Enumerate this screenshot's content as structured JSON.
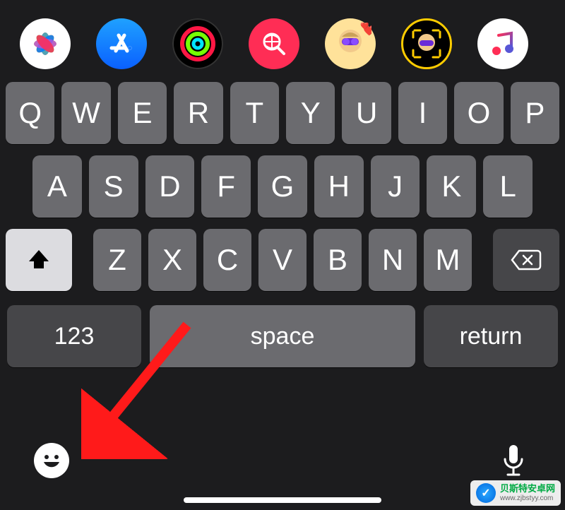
{
  "app_tray": {
    "icons": [
      {
        "name": "photos-icon"
      },
      {
        "name": "appstore-icon"
      },
      {
        "name": "activity-icon"
      },
      {
        "name": "search-app-icon"
      },
      {
        "name": "memoji-sticker-1-icon"
      },
      {
        "name": "memoji-sticker-2-icon"
      },
      {
        "name": "music-icon"
      }
    ]
  },
  "keyboard": {
    "row1": [
      "Q",
      "W",
      "E",
      "R",
      "T",
      "Y",
      "U",
      "I",
      "O",
      "P"
    ],
    "row2": [
      "A",
      "S",
      "D",
      "F",
      "G",
      "H",
      "J",
      "K",
      "L"
    ],
    "row3": [
      "Z",
      "X",
      "C",
      "V",
      "B",
      "N",
      "M"
    ],
    "numbers_key": "123",
    "space_label": "space",
    "return_label": "return"
  },
  "bottom": {
    "emoji": "emoji-keyboard-button",
    "dictate": "dictation-button"
  },
  "annotation": {
    "type": "arrow",
    "color": "#ff1a1a",
    "points_to": "emoji-keyboard-button"
  },
  "watermark": {
    "line1": "贝斯特安卓网",
    "line2": "www.zjbstyy.com"
  }
}
